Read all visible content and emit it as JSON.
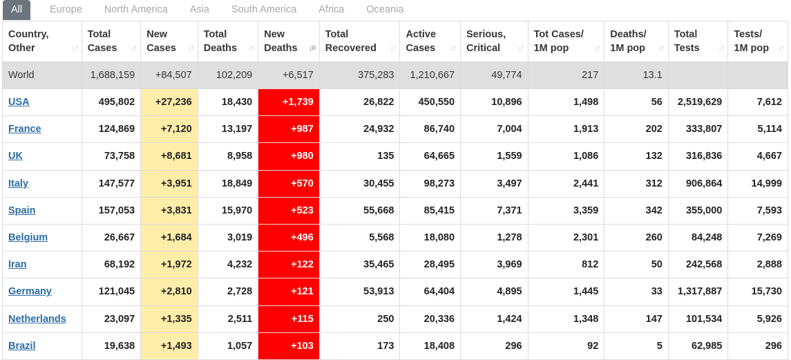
{
  "tabs": [
    "All",
    "Europe",
    "North America",
    "Asia",
    "South America",
    "Africa",
    "Oceania"
  ],
  "columns": [
    {
      "line1": "Country,",
      "line2": "Other"
    },
    {
      "line1": "Total",
      "line2": "Cases"
    },
    {
      "line1": "New",
      "line2": "Cases"
    },
    {
      "line1": "Total",
      "line2": "Deaths"
    },
    {
      "line1": "New",
      "line2": "Deaths"
    },
    {
      "line1": "Total",
      "line2": "Recovered"
    },
    {
      "line1": "Active",
      "line2": "Cases"
    },
    {
      "line1": "Serious,",
      "line2": "Critical"
    },
    {
      "line1": "Tot Cases/",
      "line2": "1M pop"
    },
    {
      "line1": "Deaths/",
      "line2": "1M pop"
    },
    {
      "line1": "Total",
      "line2": "Tests"
    },
    {
      "line1": "Tests/",
      "line2": "1M pop"
    }
  ],
  "world": [
    "World",
    "1,688,159",
    "+84,507",
    "102,209",
    "+6,517",
    "375,283",
    "1,210,667",
    "49,774",
    "217",
    "13.1",
    "",
    ""
  ],
  "rows": [
    [
      "USA",
      "495,802",
      "+27,236",
      "18,430",
      "+1,739",
      "26,822",
      "450,550",
      "10,896",
      "1,498",
      "56",
      "2,519,629",
      "7,612"
    ],
    [
      "France",
      "124,869",
      "+7,120",
      "13,197",
      "+987",
      "24,932",
      "86,740",
      "7,004",
      "1,913",
      "202",
      "333,807",
      "5,114"
    ],
    [
      "UK",
      "73,758",
      "+8,681",
      "8,958",
      "+980",
      "135",
      "64,665",
      "1,559",
      "1,086",
      "132",
      "316,836",
      "4,667"
    ],
    [
      "Italy",
      "147,577",
      "+3,951",
      "18,849",
      "+570",
      "30,455",
      "98,273",
      "3,497",
      "2,441",
      "312",
      "906,864",
      "14,999"
    ],
    [
      "Spain",
      "157,053",
      "+3,831",
      "15,970",
      "+523",
      "55,668",
      "85,415",
      "7,371",
      "3,359",
      "342",
      "355,000",
      "7,593"
    ],
    [
      "Belgium",
      "26,667",
      "+1,684",
      "3,019",
      "+496",
      "5,568",
      "18,080",
      "1,278",
      "2,301",
      "260",
      "84,248",
      "7,269"
    ],
    [
      "Iran",
      "68,192",
      "+1,972",
      "4,232",
      "+122",
      "35,465",
      "28,495",
      "3,969",
      "812",
      "50",
      "242,568",
      "2,888"
    ],
    [
      "Germany",
      "121,045",
      "+2,810",
      "2,728",
      "+121",
      "53,913",
      "64,404",
      "4,895",
      "1,445",
      "33",
      "1,317,887",
      "15,730"
    ],
    [
      "Netherlands",
      "23,097",
      "+1,335",
      "2,511",
      "+115",
      "250",
      "20,336",
      "1,424",
      "1,348",
      "147",
      "101,534",
      "5,926"
    ],
    [
      "Brazil",
      "19,638",
      "+1,493",
      "1,057",
      "+103",
      "173",
      "18,408",
      "296",
      "92",
      "5",
      "62,985",
      "296"
    ]
  ],
  "colors": {
    "new_cases_bg": "#ffeeaa",
    "new_deaths_bg": "#ff0000",
    "world_bg": "#dfdfdf",
    "link": "#2b6ca3",
    "tab_active_bg": "#6c757d"
  },
  "icons": {
    "sort": "sort-arrows-icon",
    "sort_active": "sort-desc-icon"
  }
}
